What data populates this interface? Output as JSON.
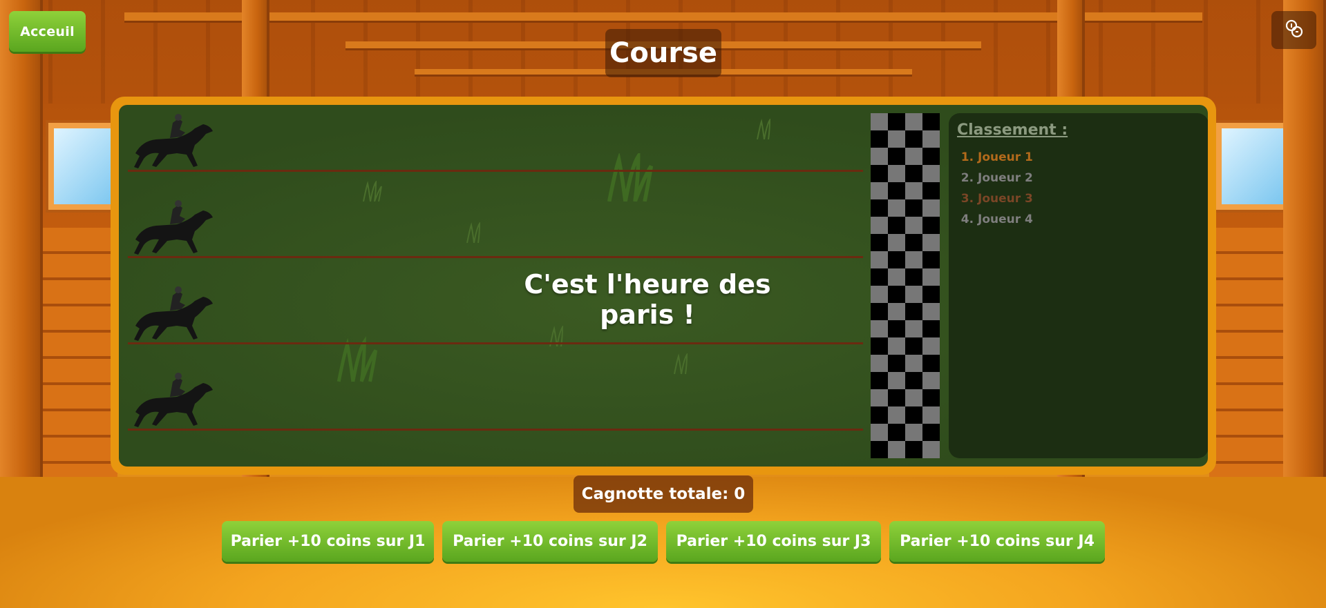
{
  "header": {
    "home_label": "Acceuil",
    "title": "Course",
    "coins_icon": "coins-icon"
  },
  "race": {
    "message": "C'est l'heure des paris !",
    "horse_icon": "horse-jockey-icon",
    "lanes": 4
  },
  "ranking": {
    "title": "Classement :",
    "items": [
      {
        "label": "Joueur 1",
        "color": "#b36a1b"
      },
      {
        "label": "Joueur 2",
        "color": "#7e7e7e"
      },
      {
        "label": "Joueur 3",
        "color": "#7b4626"
      },
      {
        "label": "Joueur 4",
        "color": "#7e7e7e"
      }
    ]
  },
  "pot": {
    "label": "Cagnotte totale: 0"
  },
  "bets": [
    {
      "label": "Parier +10 coins sur J1"
    },
    {
      "label": "Parier +10 coins sur J2"
    },
    {
      "label": "Parier +10 coins sur J3"
    },
    {
      "label": "Parier +10 coins sur J4"
    }
  ],
  "colors": {
    "accent_green": "#6fbb26",
    "board_border": "#e8960f",
    "track_green": "#2f4c1c"
  }
}
